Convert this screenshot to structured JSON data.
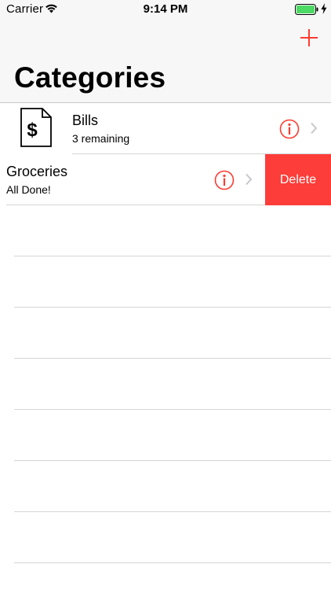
{
  "status_bar": {
    "carrier": "Carrier",
    "time": "9:14 PM",
    "battery_color": "#4cd964"
  },
  "nav": {
    "title": "Categories",
    "add_icon": "plus-icon",
    "accent_color": "#ff3b30"
  },
  "categories": [
    {
      "title": "Bills",
      "subtitle": "3 remaining",
      "icon": "dollar-document-icon"
    },
    {
      "title": "Groceries",
      "subtitle": "All Done!",
      "swiped": true
    }
  ],
  "row_actions": {
    "delete_label": "Delete",
    "delete_color": "#fc3d39"
  }
}
